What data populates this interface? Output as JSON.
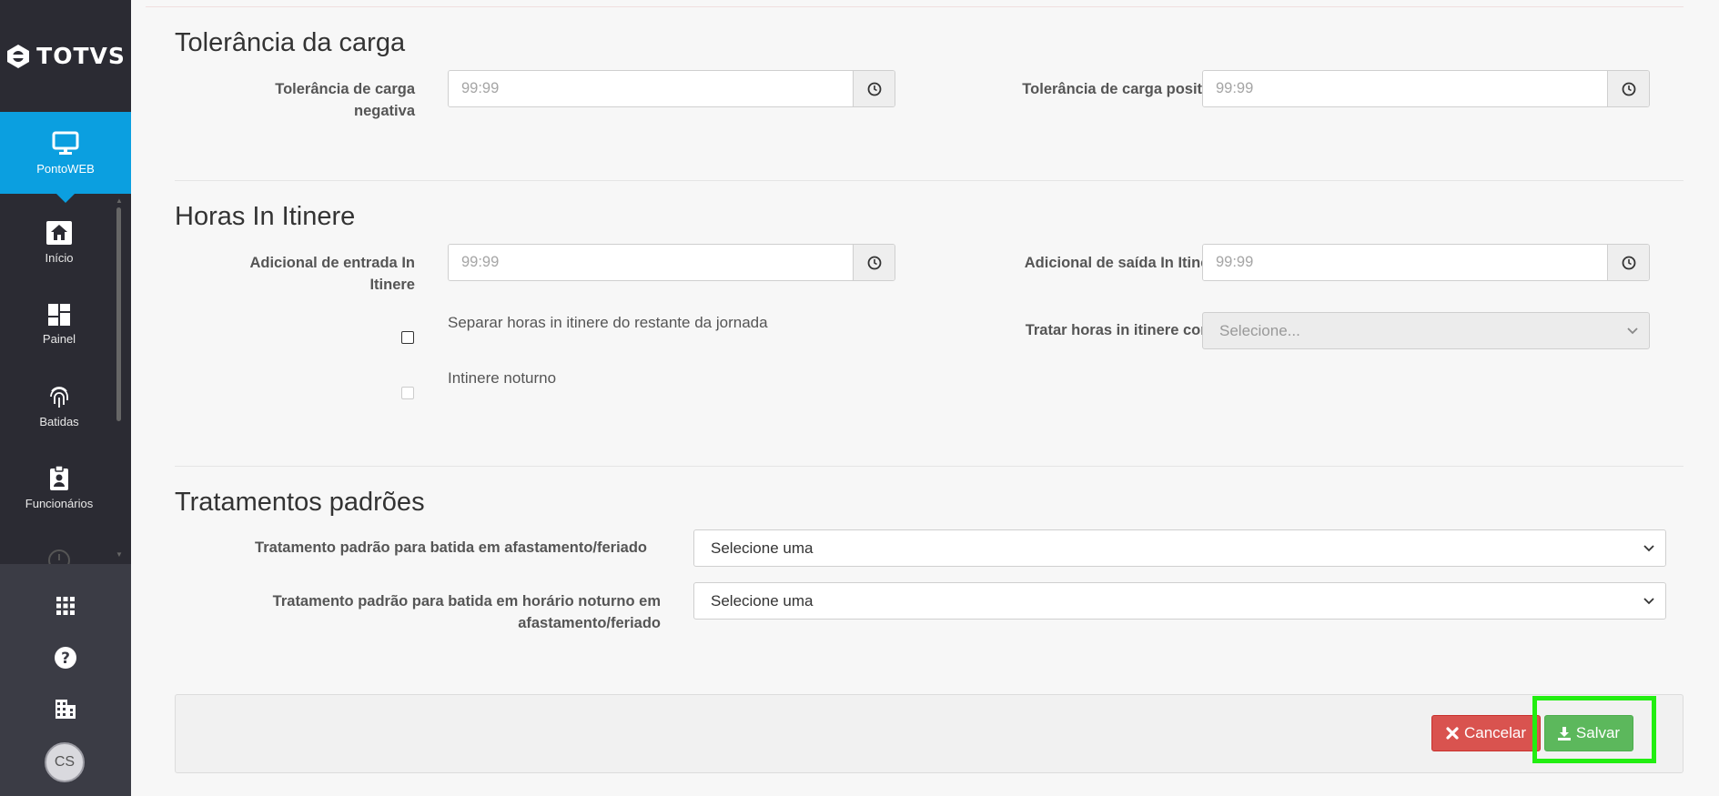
{
  "sidebar": {
    "brand": "TOTVS",
    "active_item": {
      "label": "PontoWEB",
      "icon": "monitor-icon"
    },
    "items": [
      {
        "label": "Início",
        "icon": "home-icon"
      },
      {
        "label": "Painel",
        "icon": "dashboard-icon"
      },
      {
        "label": "Batidas",
        "icon": "fingerprint-icon"
      },
      {
        "label": "Funcionários",
        "icon": "badge-icon"
      }
    ],
    "bottom_icons": [
      "apps-grid-icon",
      "help-icon",
      "building-icon"
    ],
    "avatar_initials": "CS"
  },
  "sections": {
    "tolerancia": {
      "title": "Tolerância da carga",
      "neg_label": "Tolerância de carga negativa",
      "neg_placeholder": "99:99",
      "pos_label": "Tolerância de carga positiva",
      "pos_placeholder": "99:99"
    },
    "itinere": {
      "title": "Horas In Itinere",
      "entrada_label": "Adicional de entrada In Itinere",
      "entrada_placeholder": "99:99",
      "saida_label": "Adicional de saída In Itinere",
      "saida_placeholder": "99:99",
      "separar_label": "Separar horas in itinere do restante da jornada",
      "separar_checked": false,
      "tratar_label": "Tratar horas in itinere como",
      "tratar_value": "Selecione...",
      "noturno_label": "Intinere noturno",
      "noturno_checked": false
    },
    "tratamentos": {
      "title": "Tratamentos padrões",
      "afast_label": "Tratamento padrão para batida em afastamento/feriado",
      "afast_value": "Selecione uma",
      "noturno_label": "Tratamento padrão para batida em horário noturno em afastamento/feriado",
      "noturno_value": "Selecione uma"
    }
  },
  "footer": {
    "cancel_label": "Cancelar",
    "save_label": "Salvar"
  },
  "colors": {
    "sidebar_bg": "#2b2b33",
    "active_nav": "#0b9fe0",
    "cancel": "#d9534f",
    "save": "#5cb85c",
    "highlight": "#22ee11"
  }
}
